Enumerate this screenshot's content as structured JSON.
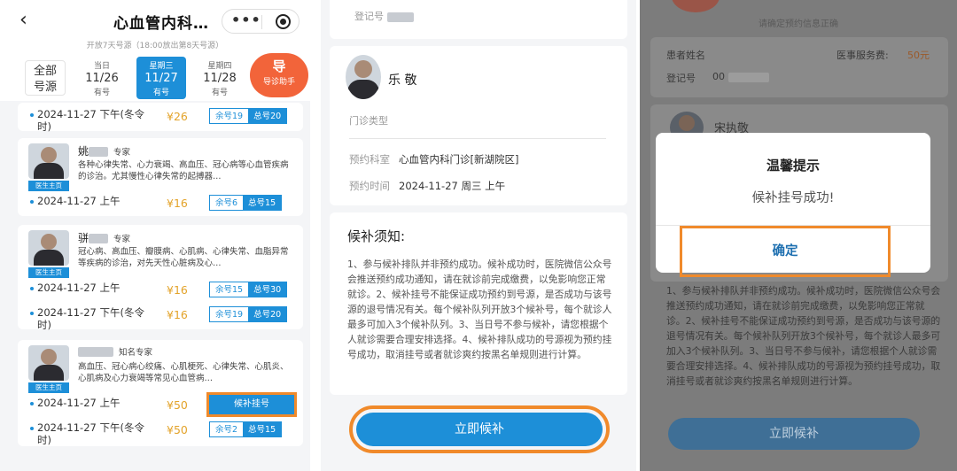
{
  "panel1": {
    "header": {
      "back_icon": "‹",
      "title": "心血管内科…",
      "more_icon": "•••",
      "target_icon": "target"
    },
    "notice": "开放7天号源（18:00放出第8天号源）",
    "all_sources": "全部\n号源",
    "dates": [
      {
        "weekday": "当日",
        "date": "11/26",
        "status": "有号",
        "active": false
      },
      {
        "weekday": "星期三",
        "date": "11/27",
        "status": "有号",
        "active": true
      },
      {
        "weekday": "星期四",
        "date": "11/28",
        "status": "有号",
        "active": false
      }
    ],
    "guide": {
      "icon": "导",
      "label": "导诊助手"
    },
    "top_slot": {
      "time": "2024-11-27 下午(冬令时)",
      "price": "¥26",
      "remaining": "余号19",
      "total": "总号20"
    },
    "doctors": [
      {
        "name": "姚",
        "title": "专家",
        "badge": "医生主页",
        "desc": "各种心律失常、心力衰竭、高血压、冠心病等心血管疾病的诊治。尤其慢性心律失常的起搏器…",
        "slots": [
          {
            "time": "2024-11-27 上午",
            "price": "¥16",
            "remaining": "余号6",
            "total": "总号15"
          }
        ]
      },
      {
        "name": "骈",
        "title": "专家",
        "badge": "医生主页",
        "desc": "冠心病、高血压、瓣膜病、心肌病、心律失常、血脂异常等疾病的诊治，对先天性心脏病及心…",
        "slots": [
          {
            "time": "2024-11-27 上午",
            "price": "¥16",
            "remaining": "余号15",
            "total": "总号30"
          },
          {
            "time": "2024-11-27 下午(冬令时)",
            "price": "¥16",
            "remaining": "余号19",
            "total": "总号20"
          }
        ]
      },
      {
        "name": "",
        "title": "知名专家",
        "badge": "医生主页",
        "desc": "高血压、冠心病心绞痛、心肌梗死、心律失常、心肌炎、心肌病及心力衰竭等常见心血管病…",
        "slots": [
          {
            "time": "2024-11-27 上午",
            "price": "¥50",
            "wait_button": "候补挂号"
          },
          {
            "time": "2024-11-27 下午(冬令时)",
            "price": "¥50",
            "remaining": "余号2",
            "total": "总号15"
          }
        ]
      }
    ]
  },
  "panel2": {
    "top_label": "登记号",
    "doctor_name": "乐 敬",
    "clinic_type_label": "门诊类型",
    "dept_label": "预约科室",
    "dept_value": "心血管内科门诊[新湖院区]",
    "time_label": "预约时间",
    "time_value": "2024-11-27 周三 上午",
    "notice_title": "候补须知:",
    "notice_body": "1、参与候补排队并非预约成功。候补成功时，医院微信公众号会推送预约成功通知，请在就诊前完成缴费，以免影响您正常就诊。2、候补挂号不能保证成功预约到号源，是否成功与该号源的退号情况有关。每个候补队列开放3个候补号，每个就诊人最多可加入3个候补队列。3、当日号不参与候补，请您根据个人就诊需要合理安排选择。4、候补排队成功的号源视为预约挂号成功，取消挂号或者就诊爽约按黑名单规则进行计算。",
    "submit_button": "立即候补"
  },
  "panel3": {
    "hint": "请确定预约信息正确",
    "patient_label": "患者姓名",
    "fee_label": "医事服务费:",
    "fee_value": "50元",
    "reg_label": "登记号",
    "reg_value": "00",
    "doctor_partial": "宋执敬",
    "modal": {
      "title": "温馨提示",
      "message": "候补挂号成功!",
      "ok": "确定"
    },
    "notes": "1、参与候补排队并非预约成功。候补成功时，医院微信公众号会推送预约成功通知，请在就诊前完成缴费，以免影响您正常就诊。2、候补挂号不能保证成功预约到号源，是否成功与该号源的退号情况有关。每个候补队列开放3个候补号，每个就诊人最多可加入3个候补队列。3、当日号不参与候补，请您根据个人就诊需要合理安排选择。4、候补排队成功的号源视为预约挂号成功，取消挂号或者就诊爽约按黑名单规则进行计算。",
    "submit_button": "立即候补"
  },
  "colors": {
    "accent": "#1d8fd8",
    "highlight": "#f08a2b",
    "price": "#e3a32a",
    "guide": "#f2643a"
  }
}
